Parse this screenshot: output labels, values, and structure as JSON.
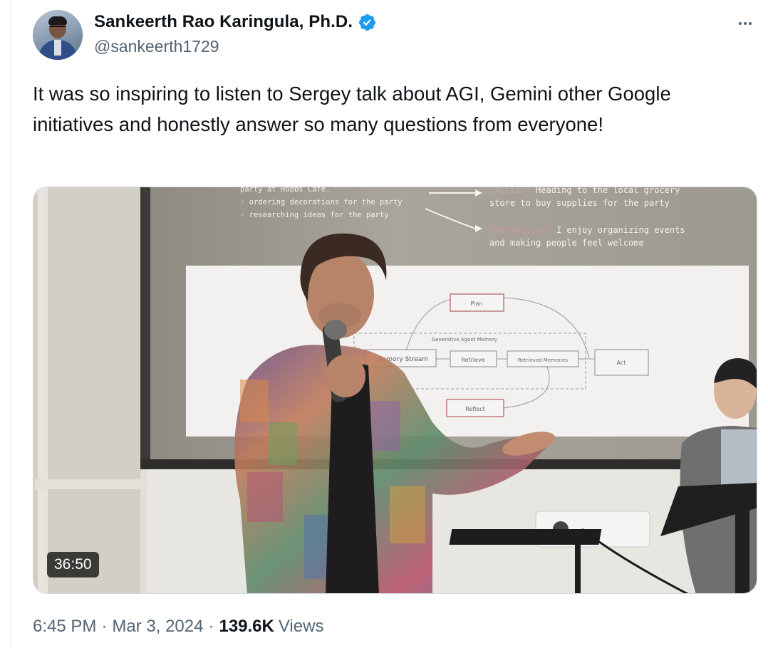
{
  "author": {
    "display_name": "Sankeerth Rao Karingula, Ph.D.",
    "handle": "@sankeerth1729",
    "verified": true,
    "verified_color": "#1d9bf0"
  },
  "tweet": {
    "text": "It was so inspiring to listen to Sergey talk about AGI, Gemini other Google initiatives and honestly answer so many questions from everyone!"
  },
  "media": {
    "type": "video",
    "duration": "36:50",
    "slide": {
      "bullets": [
        "party at Hobbs Cafe.",
        "ordering decorations for the party",
        "researching ideas for the party"
      ],
      "action_tag": "[Action]",
      "action_text_1": "Heading to the local grocery",
      "action_text_2": "store to buy supplies for the party",
      "reflection_tag": "[Reflection]",
      "reflection_text_1": "I enjoy organizing events",
      "reflection_text_2": "and making people feel welcome",
      "diagram": {
        "container_label": "Generative Agent Memory",
        "nodes": [
          "Plan",
          "Memory Stream",
          "Retrieve",
          "Retrieved Memories",
          "Act",
          "Reflect"
        ]
      }
    }
  },
  "meta": {
    "time": "6:45 PM",
    "date": "Mar 3, 2024",
    "views_count": "139.6K",
    "views_label": "Views"
  },
  "colors": {
    "text_primary": "#0f1419",
    "text_secondary": "#536471",
    "border": "#cfd9de"
  },
  "icons": {
    "verified": "verified-badge-icon",
    "more": "more-horizontal-icon"
  }
}
